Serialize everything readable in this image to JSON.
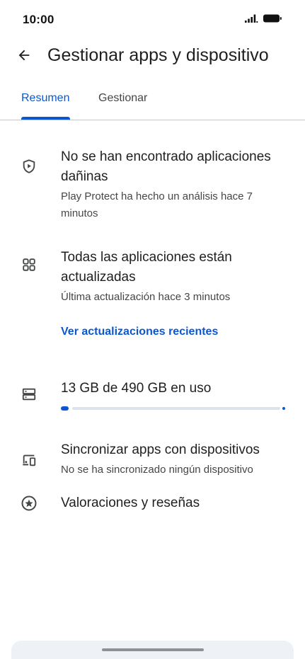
{
  "status_bar": {
    "time": "10:00"
  },
  "header": {
    "title": "Gestionar apps y dispositivo",
    "back_icon": "arrow-back-icon"
  },
  "tabs": [
    {
      "label": "Resumen",
      "selected": true
    },
    {
      "label": "Gestionar",
      "selected": false
    }
  ],
  "sections": {
    "protect": {
      "icon": "shield-play-icon",
      "title": "No se han encontrado aplicaciones dañinas",
      "subtitle": "Play Protect ha hecho un análisis hace 7 minutos"
    },
    "updates": {
      "icon": "apps-grid-icon",
      "title": "Todas las aplicaciones están actualizadas",
      "subtitle": "Última actualización hace 3 minutos",
      "link": "Ver actualizaciones recientes"
    },
    "storage": {
      "icon": "storage-icon",
      "title": "13 GB de 490 GB en uso",
      "used_fraction": 0.027
    },
    "sync": {
      "icon": "devices-icon",
      "title": "Sincronizar apps con dispositivos",
      "subtitle": "No se ha sincronizado ningún dispositivo"
    },
    "ratings": {
      "icon": "star-circle-icon",
      "title": "Valoraciones y reseñas"
    }
  },
  "colors": {
    "accent": "#0b57d0",
    "text_primary": "#1f1f1f",
    "text_secondary": "#444746",
    "progress_track": "#dde3ea"
  }
}
